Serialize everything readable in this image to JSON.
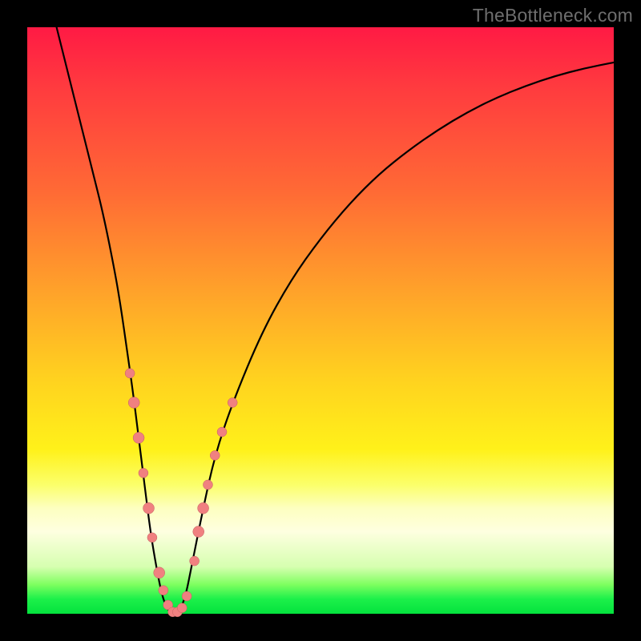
{
  "watermark": "TheBottleneck.com",
  "colors": {
    "curve_stroke": "#000000",
    "dot_fill": "#f08080",
    "dot_stroke": "#c26060"
  },
  "chart_data": {
    "type": "line",
    "title": "",
    "xlabel": "",
    "ylabel": "",
    "xlim": [
      0,
      100
    ],
    "ylim": [
      0,
      100
    ],
    "series": [
      {
        "name": "bottleneck-curve",
        "x": [
          5,
          7,
          9,
          11,
          13,
          15,
          16,
          17,
          18,
          19,
          20,
          21,
          22,
          23,
          24,
          25,
          26,
          27,
          28,
          30,
          32,
          35,
          40,
          45,
          50,
          55,
          60,
          65,
          70,
          75,
          80,
          85,
          90,
          95,
          100
        ],
        "y": [
          100,
          92,
          84,
          76,
          68,
          58,
          52,
          45,
          38,
          30,
          22,
          14,
          8,
          3,
          0.5,
          0,
          0.5,
          3,
          8,
          18,
          27,
          36,
          48,
          57,
          64,
          70,
          75,
          79,
          82.5,
          85.5,
          88,
          90,
          91.7,
          93,
          94
        ]
      }
    ],
    "scatter": [
      {
        "name": "left-branch-dots",
        "points": [
          {
            "x": 17.5,
            "y": 41,
            "r": 6
          },
          {
            "x": 18.2,
            "y": 36,
            "r": 7
          },
          {
            "x": 19.0,
            "y": 30,
            "r": 7
          },
          {
            "x": 19.8,
            "y": 24,
            "r": 6
          },
          {
            "x": 20.7,
            "y": 18,
            "r": 7
          },
          {
            "x": 21.3,
            "y": 13,
            "r": 6
          },
          {
            "x": 22.5,
            "y": 7,
            "r": 7
          },
          {
            "x": 23.2,
            "y": 4,
            "r": 6
          },
          {
            "x": 24.0,
            "y": 1.5,
            "r": 6
          }
        ]
      },
      {
        "name": "trough-dots",
        "points": [
          {
            "x": 24.8,
            "y": 0.3,
            "r": 6
          },
          {
            "x": 25.6,
            "y": 0.3,
            "r": 6
          },
          {
            "x": 26.4,
            "y": 1.0,
            "r": 6
          },
          {
            "x": 27.2,
            "y": 3.0,
            "r": 6
          }
        ]
      },
      {
        "name": "right-branch-dots",
        "points": [
          {
            "x": 28.5,
            "y": 9,
            "r": 6
          },
          {
            "x": 29.2,
            "y": 14,
            "r": 7
          },
          {
            "x": 30.0,
            "y": 18,
            "r": 7
          },
          {
            "x": 30.8,
            "y": 22,
            "r": 6
          },
          {
            "x": 32.0,
            "y": 27,
            "r": 6
          },
          {
            "x": 33.2,
            "y": 31,
            "r": 6
          },
          {
            "x": 35.0,
            "y": 36,
            "r": 6
          }
        ]
      }
    ]
  }
}
